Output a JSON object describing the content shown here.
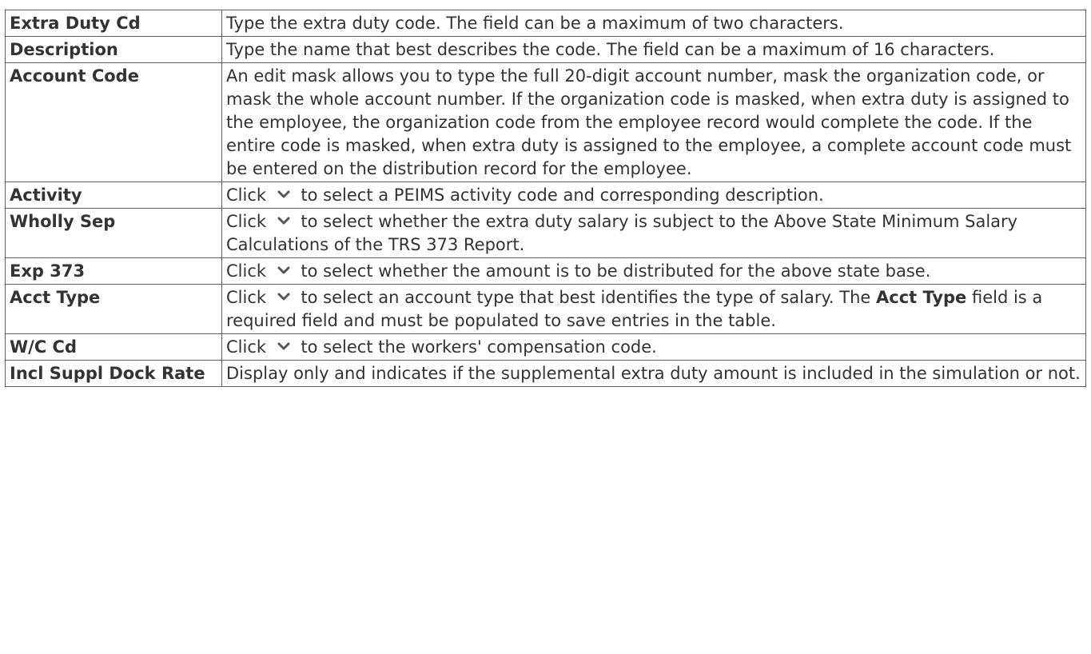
{
  "rows": [
    {
      "term": "Extra Duty Cd",
      "desc": "Type the extra duty code. The field can be a maximum of two characters."
    },
    {
      "term": "Description",
      "desc": "Type the name that best describes the code. The field can be a maximum of 16 characters."
    },
    {
      "term": "Account Code",
      "desc": "An edit mask allows you to type the full 20-digit account number, mask the organization code, or mask the whole account number. If the organization code is masked, when extra duty is assigned to the employee, the organization code from the employee record would complete the code. If the entire code is masked, when extra duty is assigned to the employee, a complete account code must be entered on the distribution record for the employee."
    },
    {
      "term": "Activity",
      "desc_pre": "Click",
      "icon": "chevron-down-icon",
      "desc": "to select a PEIMS activity code and corresponding description."
    },
    {
      "term": "Wholly Sep",
      "desc_pre": "Click",
      "icon": "chevron-down-icon",
      "desc": "to select whether the extra duty salary is subject to the Above State Minimum Salary Calculations of the TRS 373 Report."
    },
    {
      "term": "Exp 373",
      "desc_pre": "Click",
      "icon": "chevron-down-icon",
      "desc": "to select whether the amount is to be distributed for the above state base."
    },
    {
      "term": "Acct Type",
      "desc_pre": "Click",
      "icon": "chevron-down-icon",
      "desc": "to select an account type that best identifies the type of salary. The",
      "desc_bold": "Acct Type",
      "desc_post": "field is a required field and must be populated to save entries in the table."
    },
    {
      "term": "W/C Cd",
      "desc_pre": "Click",
      "icon": "chevron-down-icon",
      "desc": "to select the workers' compensation code."
    },
    {
      "term": "Incl Suppl Dock Rate",
      "desc": "Display only and indicates if the supplemental extra duty amount is included in the simulation or not."
    }
  ],
  "colors": {
    "text": "#333333",
    "border": "#606060",
    "chevron": "#555555"
  }
}
